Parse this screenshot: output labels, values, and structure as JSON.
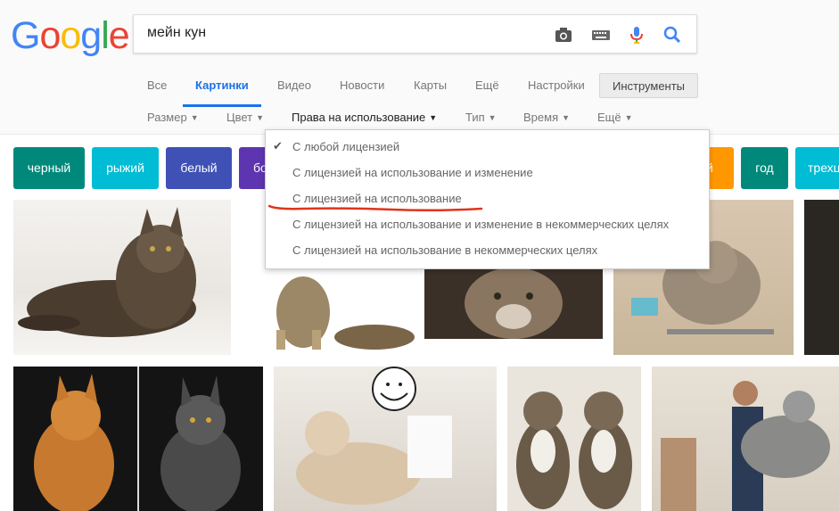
{
  "logo": {
    "letters": [
      "G",
      "o",
      "o",
      "g",
      "l",
      "e"
    ],
    "colors": [
      "#4285f4",
      "#ea4335",
      "#fbbc05",
      "#4285f4",
      "#34a853",
      "#ea4335"
    ]
  },
  "search": {
    "query": "мейн кун",
    "icons": [
      "camera-icon",
      "keyboard-icon",
      "mic-icon",
      "search-icon"
    ]
  },
  "tabs": [
    {
      "label": "Все",
      "active": false
    },
    {
      "label": "Картинки",
      "active": true
    },
    {
      "label": "Видео",
      "active": false
    },
    {
      "label": "Новости",
      "active": false
    },
    {
      "label": "Карты",
      "active": false
    },
    {
      "label": "Ещё",
      "active": false
    },
    {
      "label": "Настройки",
      "active": false
    }
  ],
  "tools_label": "Инструменты",
  "filters": [
    {
      "label": "Размер",
      "open": false
    },
    {
      "label": "Цвет",
      "open": false
    },
    {
      "label": "Права на использование",
      "open": true
    },
    {
      "label": "Тип",
      "open": false
    },
    {
      "label": "Время",
      "open": false
    },
    {
      "label": "Ещё",
      "open": false
    }
  ],
  "chips": [
    {
      "label": "черный",
      "color": "#00897b"
    },
    {
      "label": "рыжий",
      "color": "#00bcd4"
    },
    {
      "label": "белый",
      "color": "#3f51b5"
    },
    {
      "label": "бо",
      "color": "#5e35b1"
    },
    {
      "label": "й",
      "color": "#ff9800"
    },
    {
      "label": "год",
      "color": "#00897b"
    },
    {
      "label": "трехц",
      "color": "#00bcd4"
    }
  ],
  "menu": {
    "checked_index": 0,
    "items": [
      "С любой лицензией",
      "С лицензией на использование и изменение",
      "С лицензией на использование",
      "С лицензией на использование и изменение в некоммерческих целях",
      "С лицензией на использование в некоммерческих целях"
    ],
    "highlight_color": "#e0341a"
  }
}
